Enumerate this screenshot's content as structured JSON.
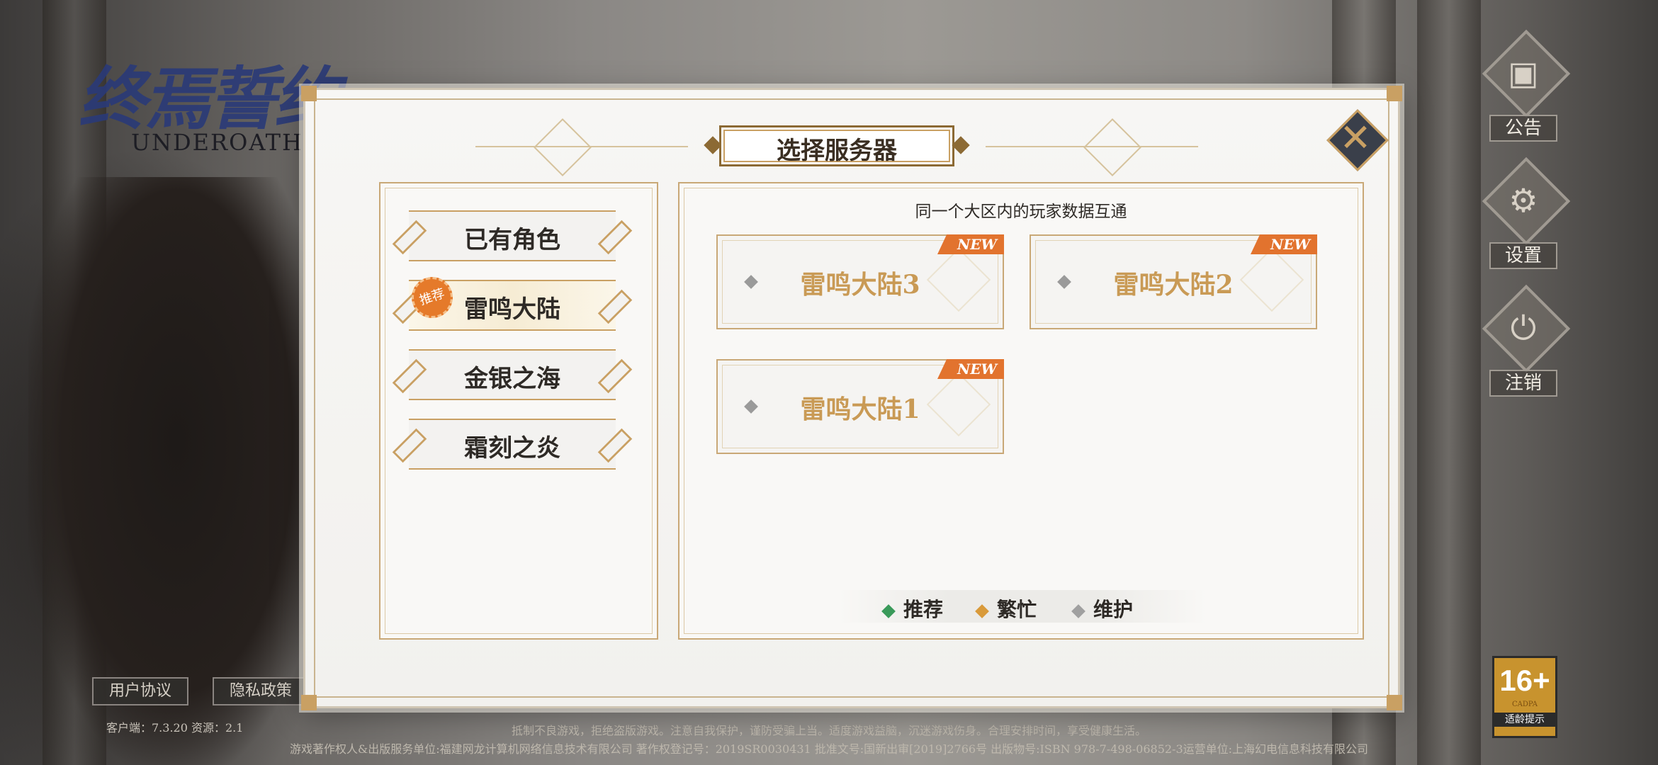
{
  "game": {
    "logo_title": "终焉誓约",
    "logo_subtitle": "UNDEROATH"
  },
  "side_menu": [
    {
      "label": "公告",
      "icon": "announcement-icon"
    },
    {
      "label": "设置",
      "icon": "gear-icon"
    },
    {
      "label": "注销",
      "icon": "power-icon"
    }
  ],
  "dialog": {
    "title": "选择服务器",
    "hint": "同一个大区内的玩家数据互通",
    "regions": [
      {
        "label": "已有角色",
        "selected": false,
        "badge": ""
      },
      {
        "label": "雷鸣大陆",
        "selected": true,
        "badge": "推荐"
      },
      {
        "label": "金银之海",
        "selected": false,
        "badge": ""
      },
      {
        "label": "霜刻之炎",
        "selected": false,
        "badge": ""
      }
    ],
    "servers": [
      {
        "name": "雷鸣大陆3",
        "tag": "NEW",
        "status": "maintenance"
      },
      {
        "name": "雷鸣大陆2",
        "tag": "NEW",
        "status": "maintenance"
      },
      {
        "name": "雷鸣大陆1",
        "tag": "NEW",
        "status": "maintenance"
      }
    ],
    "legend": [
      {
        "label": "推荐",
        "color": "#3a9a5a"
      },
      {
        "label": "繁忙",
        "color": "#d99a3a"
      },
      {
        "label": "维护",
        "color": "#a0a0a0"
      }
    ]
  },
  "footer": {
    "user_agreement": "用户协议",
    "privacy_policy": "隐私政策",
    "version": "客户端：7.3.20  资源：2.1",
    "notice_health": "抵制不良游戏，拒绝盗版游戏。注意自我保护，谨防受骗上当。适度游戏益脑，沉迷游戏伤身。合理安排时间，享受健康生活。",
    "notice_publisher": "游戏著作权人&出版服务单位:福建网龙计算机网络信息技术有限公司  著作权登记号：2019SR0030431  批准文号:国新出审[2019]2766号  出版物号:ISBN 978-7-498-06852-3运营单位:上海幻电信息科技有限公司",
    "age_rating": "16+",
    "age_org": "CADPA",
    "age_label": "适龄提示"
  },
  "colors": {
    "accent_gold": "#c9a063",
    "new_tag": "#e2732e",
    "badge_orange": "#e57a2a"
  }
}
